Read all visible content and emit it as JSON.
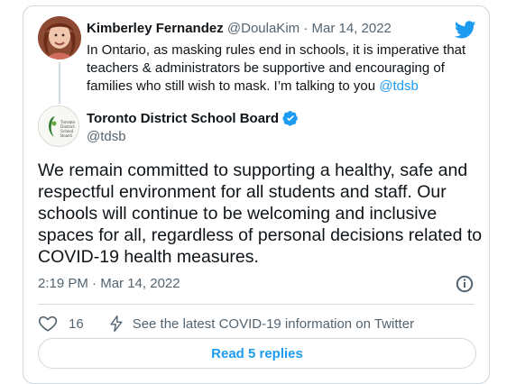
{
  "parent_tweet": {
    "author_name": "Kimberley Fernandez",
    "author_handle": "@DoulaKim",
    "separator": "·",
    "date": "Mar 14, 2022",
    "text_main": "In Ontario, as masking rules end in schools, it is imperative that teachers & administrators be supportive and encouraging of families who still wish to mask. I’m talking to you ",
    "mention": "@tdsb"
  },
  "reply_tweet": {
    "author_name": "Toronto District School Board",
    "author_handle": "@tdsb",
    "avatar_logo_text": "Toronto District School Board",
    "text": "We remain committed to supporting a healthy, safe and respectful environment for all students and staff. Our schools will continue to be welcoming and inclusive spaces for all, regardless of personal decisions related to COVID-19 health measures.",
    "time": "2:19 PM",
    "separator": "·",
    "date": "Mar 14, 2022",
    "like_count": "16",
    "covid_info_label": "See the latest COVID-19 information on Twitter",
    "read_replies_label": "Read 5 replies"
  },
  "colors": {
    "brand": "#1d9bf0",
    "text_primary": "#0f1419",
    "text_secondary": "#536471",
    "border": "#cfd9de"
  },
  "icons": {
    "brand": "twitter-bird-icon",
    "verified": "verified-badge-icon",
    "info": "info-icon",
    "like": "heart-icon",
    "covid": "bolt-icon"
  }
}
